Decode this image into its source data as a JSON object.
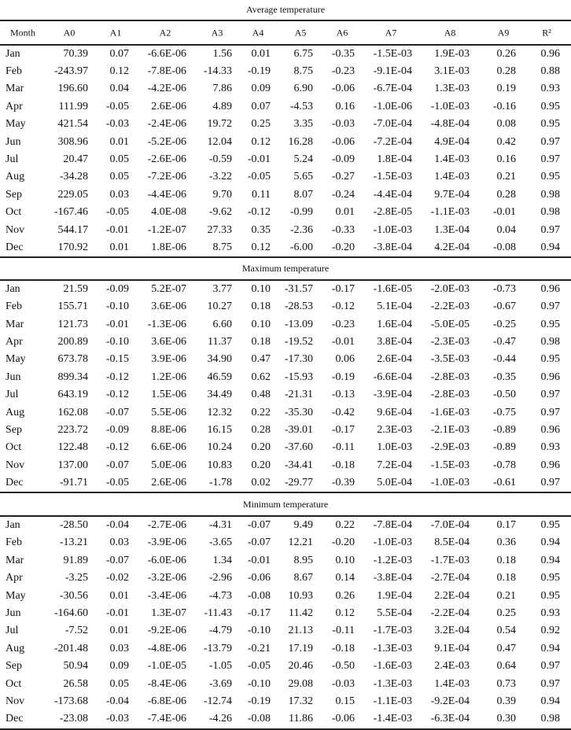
{
  "columns": [
    "Month",
    "A0",
    "A1",
    "A2",
    "A3",
    "A4",
    "A5",
    "A6",
    "A7",
    "A8",
    "A9",
    "R²"
  ],
  "sections": [
    {
      "title": "Average temperature",
      "rows": [
        {
          "month": "Jan",
          "values": [
            "70.39",
            "0.07",
            "-6.6E-06",
            "1.56",
            "0.01",
            "6.75",
            "-0.35",
            "-1.5E-03",
            "1.9E-03",
            "0.26",
            "0.96"
          ]
        },
        {
          "month": "Feb",
          "values": [
            "-243.97",
            "0.12",
            "-7.8E-06",
            "-14.33",
            "-0.19",
            "8.75",
            "-0.23",
            "-9.1E-04",
            "3.1E-03",
            "0.28",
            "0.88"
          ]
        },
        {
          "month": "Mar",
          "values": [
            "196.60",
            "0.04",
            "-4.2E-06",
            "7.86",
            "0.09",
            "6.90",
            "-0.06",
            "-6.7E-04",
            "1.3E-03",
            "0.19",
            "0.93"
          ]
        },
        {
          "month": "Apr",
          "values": [
            "111.99",
            "-0.05",
            "2.6E-06",
            "4.89",
            "0.07",
            "-4.53",
            "0.16",
            "-1.0E-06",
            "-1.0E-03",
            "-0.16",
            "0.95"
          ]
        },
        {
          "month": "May",
          "values": [
            "421.54",
            "-0.03",
            "-2.4E-06",
            "19.72",
            "0.25",
            "3.35",
            "-0.03",
            "-7.0E-04",
            "-4.8E-04",
            "0.08",
            "0.95"
          ]
        },
        {
          "month": "Jun",
          "values": [
            "308.96",
            "0.01",
            "-5.2E-06",
            "12.04",
            "0.12",
            "16.28",
            "-0.06",
            "-7.2E-04",
            "4.9E-04",
            "0.42",
            "0.97"
          ]
        },
        {
          "month": "Jul",
          "values": [
            "20.47",
            "0.05",
            "-2.6E-06",
            "-0.59",
            "-0.01",
            "5.24",
            "-0.09",
            "1.8E-04",
            "1.4E-03",
            "0.16",
            "0.97"
          ]
        },
        {
          "month": "Aug",
          "values": [
            "-34.28",
            "0.05",
            "-7.2E-06",
            "-3.22",
            "-0.05",
            "5.65",
            "-0.27",
            "-1.5E-03",
            "1.4E-03",
            "0.21",
            "0.95"
          ]
        },
        {
          "month": "Sep",
          "values": [
            "229.05",
            "0.03",
            "-4.4E-06",
            "9.70",
            "0.11",
            "8.07",
            "-0.24",
            "-4.4E-04",
            "9.7E-04",
            "0.28",
            "0.98"
          ]
        },
        {
          "month": "Oct",
          "values": [
            "-167.46",
            "-0.05",
            "4.0E-08",
            "-9.62",
            "-0.12",
            "-0.99",
            "0.01",
            "-2.8E-05",
            "-1.1E-03",
            "-0.01",
            "0.98"
          ]
        },
        {
          "month": "Nov",
          "values": [
            "544.17",
            "-0.01",
            "-1.2E-07",
            "27.33",
            "0.35",
            "-2.36",
            "-0.33",
            "-1.0E-03",
            "1.3E-04",
            "0.04",
            "0.97"
          ]
        },
        {
          "month": "Dec",
          "values": [
            "170.92",
            "0.01",
            "1.8E-06",
            "8.75",
            "0.12",
            "-6.00",
            "-0.20",
            "-3.8E-04",
            "4.2E-04",
            "-0.08",
            "0.94"
          ]
        }
      ]
    },
    {
      "title": "Maximum temperature",
      "rows": [
        {
          "month": "Jan",
          "values": [
            "21.59",
            "-0.09",
            "5.2E-07",
            "3.77",
            "0.10",
            "-31.57",
            "-0.17",
            "-1.6E-05",
            "-2.0E-03",
            "-0.73",
            "0.96"
          ]
        },
        {
          "month": "Feb",
          "values": [
            "155.71",
            "-0.10",
            "3.6E-06",
            "10.27",
            "0.18",
            "-28.53",
            "-0.12",
            "5.1E-04",
            "-2.2E-03",
            "-0.67",
            "0.97"
          ]
        },
        {
          "month": "Mar",
          "values": [
            "121.73",
            "-0.01",
            "-1.3E-06",
            "6.60",
            "0.10",
            "-13.09",
            "-0.23",
            "1.6E-04",
            "-5.0E-05",
            "-0.25",
            "0.95"
          ]
        },
        {
          "month": "Apr",
          "values": [
            "200.89",
            "-0.10",
            "3.6E-06",
            "11.37",
            "0.18",
            "-19.52",
            "-0.01",
            "3.8E-04",
            "-2.3E-03",
            "-0.47",
            "0.98"
          ]
        },
        {
          "month": "May",
          "values": [
            "673.78",
            "-0.15",
            "3.9E-06",
            "34.90",
            "0.47",
            "-17.30",
            "0.06",
            "2.6E-04",
            "-3.5E-03",
            "-0.44",
            "0.95"
          ]
        },
        {
          "month": "Jun",
          "values": [
            "899.34",
            "-0.12",
            "1.2E-06",
            "46.59",
            "0.62",
            "-15.93",
            "-0.19",
            "-6.6E-04",
            "-2.8E-03",
            "-0.35",
            "0.96"
          ]
        },
        {
          "month": "Jul",
          "values": [
            "643.19",
            "-0.12",
            "1.5E-06",
            "34.49",
            "0.48",
            "-21.31",
            "-0.13",
            "-3.9E-04",
            "-2.8E-03",
            "-0.50",
            "0.97"
          ]
        },
        {
          "month": "Aug",
          "values": [
            "162.08",
            "-0.07",
            "5.5E-06",
            "12.32",
            "0.22",
            "-35.30",
            "-0.42",
            "9.6E-04",
            "-1.6E-03",
            "-0.75",
            "0.97"
          ]
        },
        {
          "month": "Sep",
          "values": [
            "223.72",
            "-0.09",
            "8.8E-06",
            "16.15",
            "0.28",
            "-39.01",
            "-0.17",
            "2.3E-03",
            "-2.1E-03",
            "-0.89",
            "0.96"
          ]
        },
        {
          "month": "Oct",
          "values": [
            "122.48",
            "-0.12",
            "6.6E-06",
            "10.24",
            "0.20",
            "-37.60",
            "-0.11",
            "1.0E-03",
            "-2.9E-03",
            "-0.89",
            "0.93"
          ]
        },
        {
          "month": "Nov",
          "values": [
            "137.00",
            "-0.07",
            "5.0E-06",
            "10.83",
            "0.20",
            "-34.41",
            "-0.18",
            "7.2E-04",
            "-1.5E-03",
            "-0.78",
            "0.96"
          ]
        },
        {
          "month": "Dec",
          "values": [
            "-91.71",
            "-0.05",
            "2.6E-06",
            "-1.78",
            "0.02",
            "-29.77",
            "-0.39",
            "5.0E-04",
            "-1.0E-03",
            "-0.61",
            "0.97"
          ]
        }
      ]
    },
    {
      "title": "Minimum temperature",
      "rows": [
        {
          "month": "Jan",
          "values": [
            "-28.50",
            "-0.04",
            "-2.7E-06",
            "-4.31",
            "-0.07",
            "9.49",
            "0.22",
            "-7.8E-04",
            "-7.0E-04",
            "0.17",
            "0.95"
          ]
        },
        {
          "month": "Feb",
          "values": [
            "-13.21",
            "0.03",
            "-3.9E-06",
            "-3.65",
            "-0.07",
            "12.21",
            "-0.20",
            "-1.0E-03",
            "8.5E-04",
            "0.36",
            "0.94"
          ]
        },
        {
          "month": "Mar",
          "values": [
            "91.89",
            "-0.07",
            "-6.0E-06",
            "1.34",
            "-0.01",
            "8.95",
            "0.10",
            "-1.2E-03",
            "-1.7E-03",
            "0.18",
            "0.94"
          ]
        },
        {
          "month": "Apr",
          "values": [
            "-3.25",
            "-0.02",
            "-3.2E-06",
            "-2.96",
            "-0.06",
            "8.67",
            "0.14",
            "-3.8E-04",
            "-2.7E-04",
            "0.18",
            "0.95"
          ]
        },
        {
          "month": "May",
          "values": [
            "-30.56",
            "0.01",
            "-3.4E-06",
            "-4.73",
            "-0.08",
            "10.93",
            "0.26",
            "1.9E-04",
            "2.2E-04",
            "0.21",
            "0.95"
          ]
        },
        {
          "month": "Jun",
          "values": [
            "-164.60",
            "-0.01",
            "1.3E-07",
            "-11.43",
            "-0.17",
            "11.42",
            "0.12",
            "5.5E-04",
            "-2.2E-04",
            "0.25",
            "0.93"
          ]
        },
        {
          "month": "Jul",
          "values": [
            "-7.52",
            "0.01",
            "-9.2E-06",
            "-4.79",
            "-0.10",
            "21.13",
            "-0.11",
            "-1.7E-03",
            "3.2E-04",
            "0.54",
            "0.92"
          ]
        },
        {
          "month": "Aug",
          "values": [
            "-201.48",
            "0.03",
            "-4.8E-06",
            "-13.79",
            "-0.21",
            "17.19",
            "-0.18",
            "-1.3E-03",
            "9.1E-04",
            "0.47",
            "0.94"
          ]
        },
        {
          "month": "Sep",
          "values": [
            "50.94",
            "0.09",
            "-1.0E-05",
            "-1.05",
            "-0.05",
            "20.46",
            "-0.50",
            "-1.6E-03",
            "2.4E-03",
            "0.64",
            "0.97"
          ]
        },
        {
          "month": "Oct",
          "values": [
            "26.58",
            "0.05",
            "-8.4E-06",
            "-3.69",
            "-0.10",
            "29.08",
            "-0.03",
            "-1.3E-03",
            "1.4E-03",
            "0.73",
            "0.97"
          ]
        },
        {
          "month": "Nov",
          "values": [
            "-173.68",
            "-0.04",
            "-6.8E-06",
            "-12.74",
            "-0.19",
            "17.32",
            "0.15",
            "-1.1E-03",
            "-9.2E-04",
            "0.39",
            "0.94"
          ]
        },
        {
          "month": "Dec",
          "values": [
            "-23.08",
            "-0.03",
            "-7.4E-06",
            "-4.26",
            "-0.08",
            "11.86",
            "-0.06",
            "-1.4E-03",
            "-6.3E-04",
            "0.30",
            "0.98"
          ]
        }
      ]
    }
  ]
}
